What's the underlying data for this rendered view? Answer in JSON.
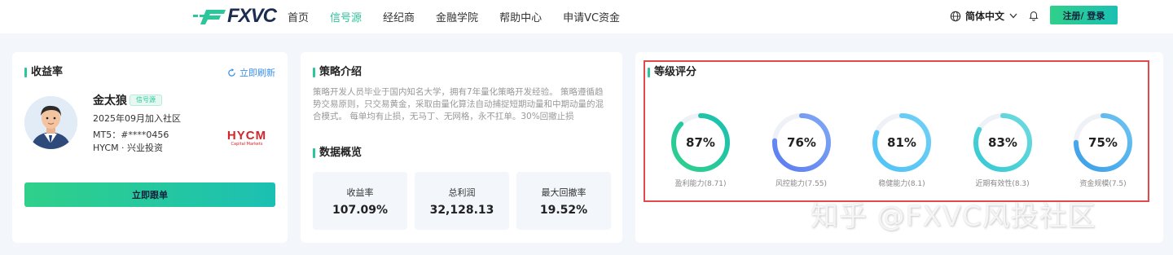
{
  "header": {
    "logo_text": "FXVC",
    "nav": [
      "首页",
      "信号源",
      "经纪商",
      "金融学院",
      "帮助中心",
      "申请VC资金"
    ],
    "active_nav": 1,
    "language": "简体中文",
    "auth_label": "注册/ 登录"
  },
  "yield_card": {
    "title": "收益率",
    "refresh_label": "立即刷新",
    "trader_name": "金太狼",
    "badge": "信号源",
    "joined": "2025年09月加入社区",
    "mt5": "MT5：#****0456",
    "broker": "HYCM · 兴业投资",
    "broker_logo": "HYCM",
    "broker_logo_sub": "Capital Markets",
    "follow_label": "立即跟单"
  },
  "strategy_card": {
    "title": "策略介绍",
    "description": "策略开发人员毕业于国内知名大学，拥有7年量化策略开发经验。 策略遵循趋势交易原则，只交易黄金，采取由量化算法自动捕捉短期动量和中期动量的混合模式。 每单均有止损，无马丁、无网格，永不扛单。30%回撤止损",
    "overview_title": "数据概览",
    "stats": [
      {
        "label": "收益率",
        "value": "107.09%"
      },
      {
        "label": "总利润",
        "value": "32,128.13"
      },
      {
        "label": "最大回撤率",
        "value": "19.52%"
      }
    ]
  },
  "rating_card": {
    "title": "等级评分",
    "gauges": [
      {
        "percent": 87,
        "text": "87%",
        "label": "盈利能力(8.71)",
        "color_start": "#2fd08a",
        "color_end": "#1cc0b2"
      },
      {
        "percent": 76,
        "text": "76%",
        "label": "风控能力(7.55)",
        "color_start": "#5b7cf0",
        "color_end": "#7fa8f5"
      },
      {
        "percent": 81,
        "text": "81%",
        "label": "稳健能力(8.1)",
        "color_start": "#4fc3f7",
        "color_end": "#6fd0f5"
      },
      {
        "percent": 83,
        "text": "83%",
        "label": "近期有效性(8.3)",
        "color_start": "#34c9d2",
        "color_end": "#6edbe0"
      },
      {
        "percent": 75,
        "text": "75%",
        "label": "资金规模(7.5)",
        "color_start": "#3a9ee8",
        "color_end": "#6cc4f2"
      }
    ]
  },
  "watermark": "知乎 @FXVC风投社区"
}
